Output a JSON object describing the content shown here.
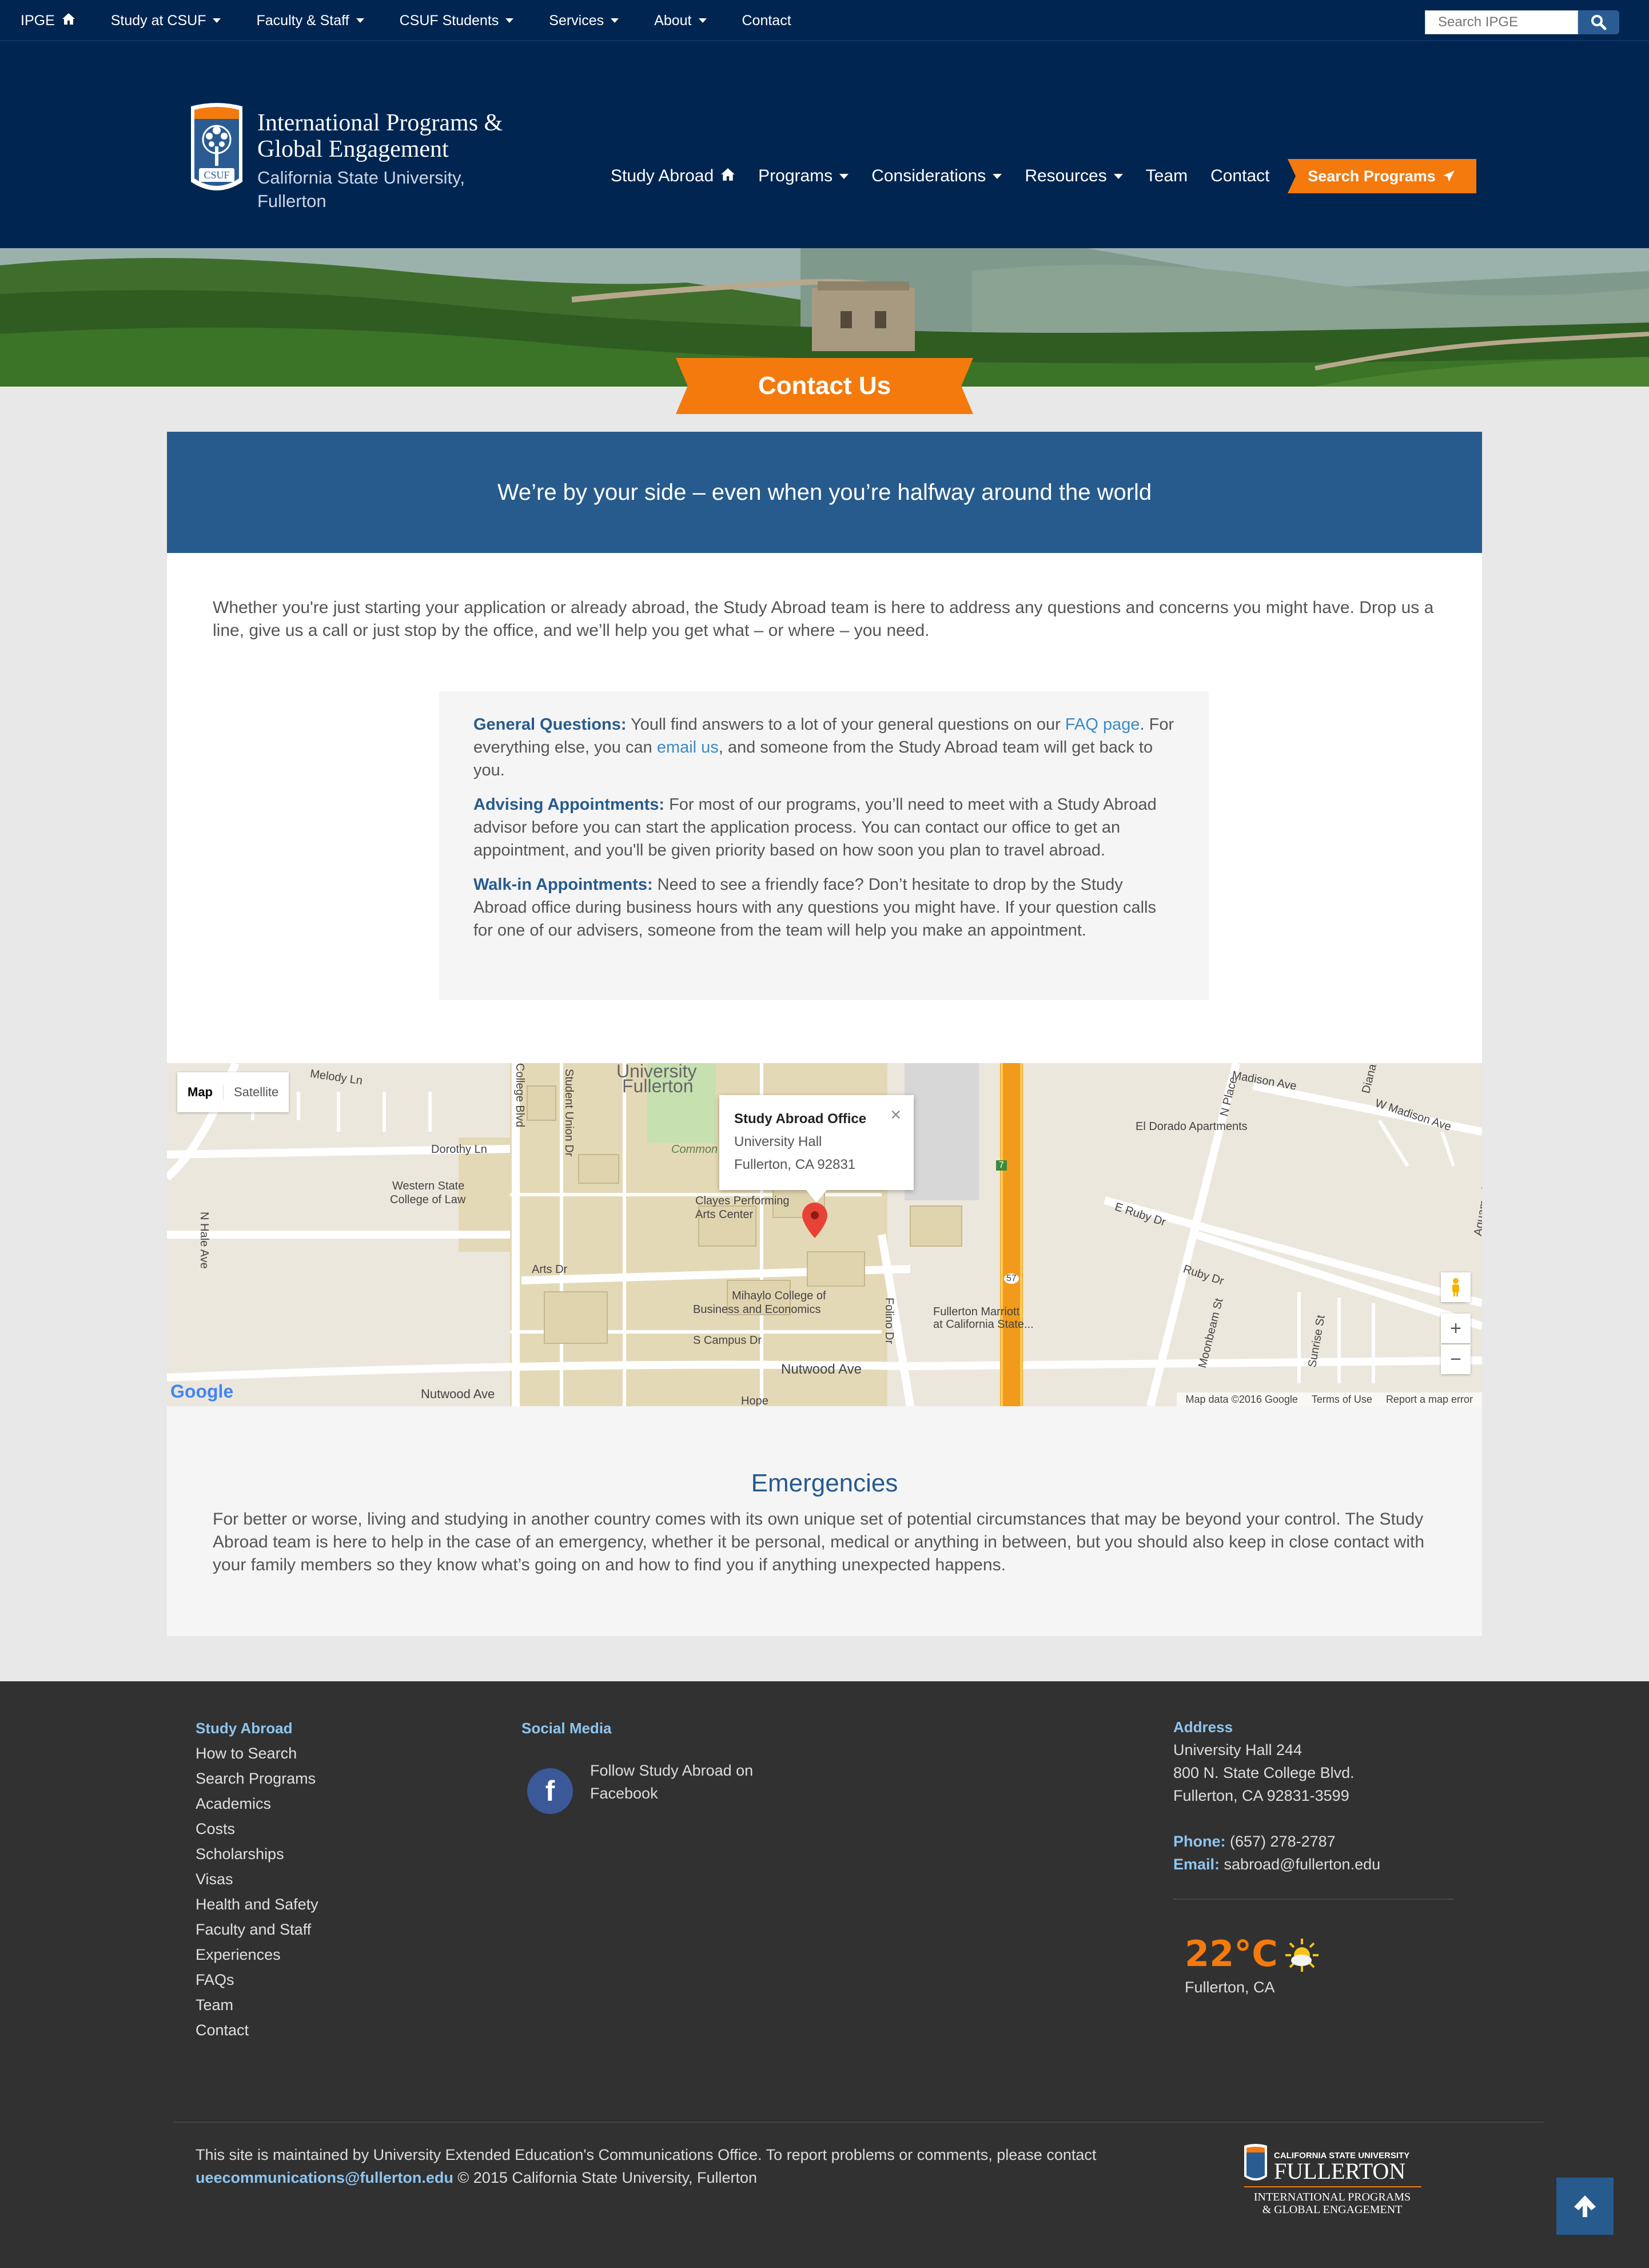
{
  "topbar": {
    "items": [
      {
        "label": "IPGE",
        "icon": "home-icon"
      },
      {
        "label": "Study at CSUF",
        "icon": "caret-down-icon"
      },
      {
        "label": "Faculty & Staff",
        "icon": "caret-down-icon"
      },
      {
        "label": "CSUF Students",
        "icon": "caret-down-icon"
      },
      {
        "label": "Services",
        "icon": "caret-down-icon"
      },
      {
        "label": "About",
        "icon": "caret-down-icon"
      },
      {
        "label": "Contact"
      }
    ],
    "search_placeholder": "Search IPGE"
  },
  "header": {
    "title_line1": "International Programs &",
    "title_line2": "Global Engagement",
    "sub_line1": "California State University,",
    "sub_line2": "Fullerton",
    "logo_text": "CSUF",
    "nav": [
      {
        "label": "Study Abroad",
        "icon": "home-icon"
      },
      {
        "label": "Programs",
        "icon": "caret-down-icon"
      },
      {
        "label": "Considerations",
        "icon": "caret-down-icon"
      },
      {
        "label": "Resources",
        "icon": "caret-down-icon"
      },
      {
        "label": "Team"
      },
      {
        "label": "Contact"
      }
    ],
    "search_programs": "Search Programs"
  },
  "hero": {
    "ribbon": "Contact Us"
  },
  "main": {
    "banner": "We’re by your side – even when you’re halfway around the world",
    "intro": "Whether you're just starting your application or already abroad, the Study Abroad team is here to address any questions and concerns you might have. Drop us a line, give us a call or just stop by the office, and we’ll help you get what – or where – you need.",
    "general_label": "General Questions:",
    "general_pre": " Youll find answers to a lot of your general questions on our ",
    "general_faq": "FAQ page",
    "general_mid": ". For everything else, you can ",
    "general_email": "email us",
    "general_post": ", and someone from the Study Abroad team will get back to you.",
    "advising_label": "Advising Appointments:",
    "advising_text": " For most of our programs, you’ll need to meet with a Study Abroad advisor before you can start the application process. You can contact our office to get an appointment, and you'll be given priority based on how soon you plan to travel abroad.",
    "walkin_label": "Walk-in Appointments:",
    "walkin_text": " Need to see a friendly face? Don’t hesitate to drop by the Study Abroad office during business hours with any questions you might have. If your question calls for one of our advisers, someone from the team will help you make an appointment."
  },
  "map": {
    "type_map": "Map",
    "type_satellite": "Satellite",
    "popup_title": "Study Abroad Office",
    "popup_line1": "University Hall",
    "popup_line2": "Fullerton, CA 92831",
    "labels": {
      "melody": "Melody Ln",
      "university": "University",
      "fullerton": "Fullerton",
      "college_blvd": "College Blvd",
      "student_union": "Student Union Dr",
      "common": "Common",
      "dorothy": "Dorothy Ln",
      "western": "Western State",
      "western2": "College of Law",
      "clayes": "Clayes Performing",
      "clayes2": "Arts Center",
      "hale": "N Hale Ave",
      "arts": "Arts Dr",
      "mihaylo": "Mihaylo College of",
      "mihaylo2": "Business and Economics",
      "campus": "S Campus Dr",
      "nutwood": "Nutwood Ave",
      "nutwood2": "Nutwood Ave",
      "folino": "Folino Dr",
      "marriott": "Fullerton Marriott",
      "marriott2": "at California State...",
      "eldorado": "El Dorado Apartments",
      "madison": "Madison Ave",
      "wmadison": "W Madison Ave",
      "eruby": "E Ruby Dr",
      "ruby": "Ruby Dr",
      "moonbeam": "Moonbeam St",
      "sunrise": "Sunrise St",
      "aquamarine": "Aquamarine St",
      "nplace": "N Place",
      "diana": "Diana",
      "r57": "57",
      "r7": "7",
      "hope": "Hope"
    },
    "footer_data": "Map data ©2016 Google",
    "footer_terms": "Terms of Use",
    "footer_report": "Report a map error",
    "google": "Google"
  },
  "emergencies": {
    "title": "Emergencies",
    "text": "For better or worse, living and studying in another country comes with its own unique set of potential circumstances that may be beyond your control. The Study Abroad team is here to help in the case of an emergency, whether it be personal, medical or anything in between, but you should also keep in close contact with your family members so they know what’s going on and how to find you if anything unexpected happens."
  },
  "footer": {
    "study_abroad_title": "Study Abroad",
    "links": [
      "How to Search",
      "Search Programs",
      "Academics",
      "Costs",
      "Scholarships",
      "Visas",
      "Health and Safety",
      "Faculty and Staff",
      "Experiences",
      "FAQs",
      "Team",
      "Contact"
    ],
    "social_title": "Social Media",
    "facebook_text": "Follow Study Abroad on Facebook",
    "address_title": "Address",
    "address_line1": "University Hall 244",
    "address_line2": "800 N. State College Blvd.",
    "address_line3": "Fullerton, CA 92831-3599",
    "phone_label": "Phone:",
    "phone": " (657) 278-2787",
    "email_label": "Email:",
    "email": " sabroad@fullerton.edu",
    "weather_temp": "22°C",
    "weather_city": "Fullerton, CA",
    "copyright_text": "This site is maintained by University Extended Education's Communications Office. To report problems or comments, please contact",
    "copyright_email": "ueecommunications@fullerton.edu",
    "copyright_year": " © 2015 California State University, Fullerton",
    "logo_line1": "CALIFORNIA STATE UNIVERSITY",
    "logo_line2": "FULLERTON",
    "logo_line3": "INTERNATIONAL PROGRAMS",
    "logo_line4": "& GLOBAL ENGAGEMENT"
  },
  "colors": {
    "navy": "#002551",
    "orange": "#f47a0d",
    "blue": "#275b8d",
    "footer": "#313131",
    "link": "#8ec5ef"
  }
}
